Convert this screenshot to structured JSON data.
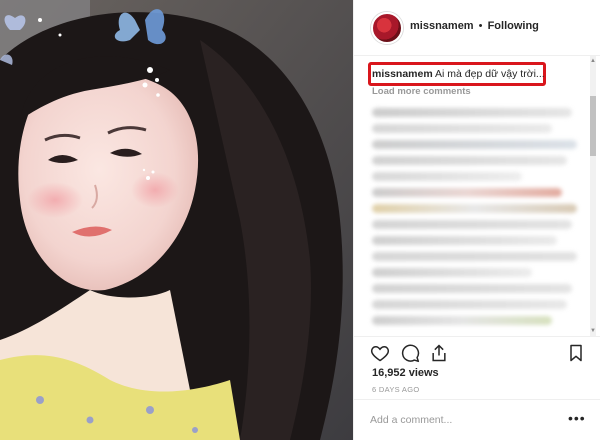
{
  "post": {
    "username": "missnamem",
    "separator": "•",
    "follow_status": "Following",
    "caption_user": "missnamem",
    "caption_text": "Ai mà đẹp dữ vậy trời...",
    "load_more": "Load more comments",
    "views": "16,952 views",
    "date": "6 DAYS AGO",
    "add_comment_placeholder": "Add a comment...",
    "more_options": "•••"
  },
  "colors": {
    "highlight": "#d9161c",
    "muted_text": "#999999",
    "text": "#262626"
  },
  "icons": [
    "heart-icon",
    "comment-icon",
    "share-icon",
    "bookmark-icon"
  ]
}
